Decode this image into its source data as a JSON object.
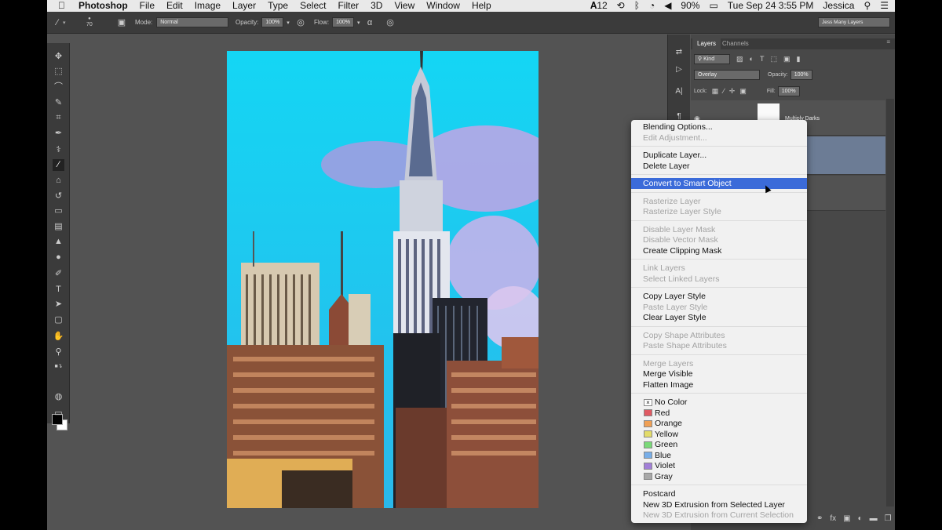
{
  "menubar": {
    "app": "Photoshop",
    "menus": [
      "File",
      "Edit",
      "Image",
      "Layer",
      "Type",
      "Select",
      "Filter",
      "3D",
      "View",
      "Window",
      "Help"
    ],
    "status": {
      "notification_count": "12",
      "battery": "90%",
      "datetime": "Tue Sep 24  3:55 PM",
      "user": "Jessica"
    }
  },
  "options_bar": {
    "brush_size": "70",
    "mode_label": "Mode:",
    "mode_value": "Normal",
    "opacity_label": "Opacity:",
    "opacity_value": "100%",
    "flow_label": "Flow:",
    "flow_value": "100%",
    "workspace": "Jess Many Layers"
  },
  "layers_panel": {
    "tabs": [
      "Layers",
      "Channels"
    ],
    "filter_kind": "Kind",
    "blend_mode": "Overlay",
    "opacity_label": "Opacity:",
    "opacity_value": "100%",
    "lock_label": "Lock:",
    "fill_label": "Fill:",
    "fill_value": "100%",
    "layer_name_partial": "Multiply Darks"
  },
  "context_menu": {
    "groups": [
      [
        {
          "label": "Blending Options...",
          "enabled": true
        },
        {
          "label": "Edit Adjustment...",
          "enabled": false
        }
      ],
      [
        {
          "label": "Duplicate Layer...",
          "enabled": true
        },
        {
          "label": "Delete Layer",
          "enabled": true
        }
      ],
      [
        {
          "label": "Convert to Smart Object",
          "enabled": true,
          "highlighted": true
        }
      ],
      [
        {
          "label": "Rasterize Layer",
          "enabled": false
        },
        {
          "label": "Rasterize Layer Style",
          "enabled": false
        }
      ],
      [
        {
          "label": "Disable Layer Mask",
          "enabled": false
        },
        {
          "label": "Disable Vector Mask",
          "enabled": false
        },
        {
          "label": "Create Clipping Mask",
          "enabled": true
        }
      ],
      [
        {
          "label": "Link Layers",
          "enabled": false
        },
        {
          "label": "Select Linked Layers",
          "enabled": false
        }
      ],
      [
        {
          "label": "Copy Layer Style",
          "enabled": true
        },
        {
          "label": "Paste Layer Style",
          "enabled": false
        },
        {
          "label": "Clear Layer Style",
          "enabled": true
        }
      ],
      [
        {
          "label": "Copy Shape Attributes",
          "enabled": false
        },
        {
          "label": "Paste Shape Attributes",
          "enabled": false
        }
      ],
      [
        {
          "label": "Merge Layers",
          "enabled": false
        },
        {
          "label": "Merge Visible",
          "enabled": true
        },
        {
          "label": "Flatten Image",
          "enabled": true
        }
      ]
    ],
    "colors": [
      {
        "label": "No Color",
        "color": "#ffffff"
      },
      {
        "label": "Red",
        "color": "#e05a63"
      },
      {
        "label": "Orange",
        "color": "#f0a055"
      },
      {
        "label": "Yellow",
        "color": "#e3dc6a"
      },
      {
        "label": "Green",
        "color": "#7ad978"
      },
      {
        "label": "Blue",
        "color": "#78aee8"
      },
      {
        "label": "Violet",
        "color": "#a27fd8"
      },
      {
        "label": "Gray",
        "color": "#a8a8a8"
      }
    ],
    "footer": [
      {
        "label": "Postcard",
        "enabled": true
      },
      {
        "label": "New 3D Extrusion from Selected Layer",
        "enabled": true
      },
      {
        "label": "New 3D Extrusion from Current Selection",
        "enabled": false
      }
    ]
  },
  "colors": {
    "ui_dark": "#3b3b3b",
    "ui_mid": "#535353",
    "highlight": "#3b6bd9",
    "sky": "#12d0f0"
  }
}
